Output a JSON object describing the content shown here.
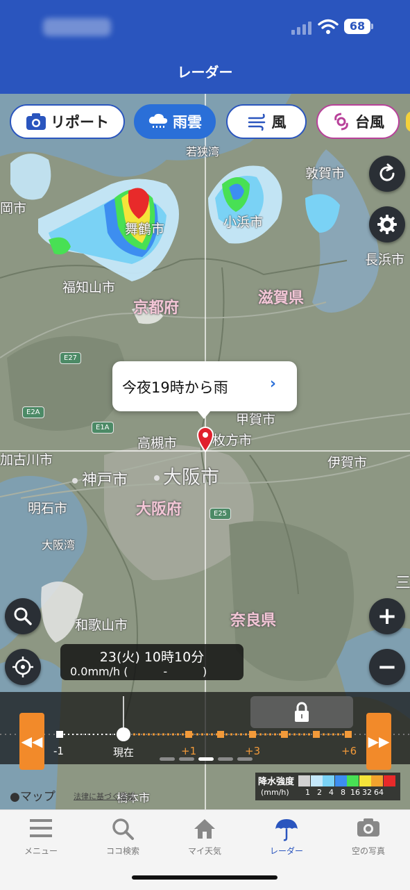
{
  "status_bar": {
    "battery": "68"
  },
  "header": {
    "title": "レーダー"
  },
  "layers": [
    {
      "label": "リポート",
      "icon": "camera-icon"
    },
    {
      "label": "雨雲",
      "icon": "cloud-rain-icon",
      "active": true
    },
    {
      "label": "風",
      "icon": "wind-icon"
    },
    {
      "label": "台風",
      "icon": "typhoon-icon"
    }
  ],
  "map": {
    "places": {
      "wakasa_bay": "若狭湾",
      "tsuruga": "敦賀市",
      "maizuru": "舞鶴市",
      "obama": "小浜市",
      "nagahama": "長浜市",
      "fukuchiyama": "福知山市",
      "kyoto_pref": "京都府",
      "shiga_pref": "滋賀県",
      "koka": "甲賀市",
      "takatsuki": "高槻市",
      "hirakata": "枚方市",
      "kakogawa": "加古川市",
      "iga": "伊賀市",
      "kobe": "神戸市",
      "osaka_city": "大阪市",
      "osaka_pref": "大阪府",
      "akashi": "明石市",
      "osaka_bay": "大阪湾",
      "wakayama": "和歌山市",
      "nara_pref": "奈良県",
      "left_edge_city": "岡市",
      "right_edge_mark": "三",
      "bottom_city": "橋本市"
    },
    "shields": [
      "E27",
      "E2A",
      "E1A",
      "E25"
    ],
    "pin_callout": "今夜19時から雨",
    "callout_chevron": "›"
  },
  "controls": {
    "refresh": "refresh-icon",
    "settings": "gear-icon",
    "search": "search-icon",
    "locate": "locate-icon",
    "zoom_in": "+",
    "zoom_out": "−"
  },
  "time_info": {
    "datetime": "23(火) 10時10分",
    "precip": "0.0mm/h (          -          )"
  },
  "timeline": {
    "labels": [
      "-1",
      "現在",
      "+1",
      "+3",
      "+6"
    ],
    "rewind": "◀◀",
    "forward": "▶▶"
  },
  "legend": {
    "title": "降水強度",
    "unit": "(mm/h)",
    "values": [
      "1",
      "2",
      "4",
      "8",
      "16",
      "32",
      "64"
    ],
    "colors": [
      "#d2d2d2",
      "#c5e8fa",
      "#7ad2f5",
      "#3d8ef0",
      "#48e054",
      "#f5e43a",
      "#f2a32e",
      "#e82a2a"
    ]
  },
  "attribution": {
    "maps": "マップ",
    "legal": "法律に基づく情報"
  },
  "tabs": [
    {
      "label": "メニュー",
      "icon": "menu-icon"
    },
    {
      "label": "ココ検索",
      "icon": "search-icon"
    },
    {
      "label": "マイ天気",
      "icon": "home-icon"
    },
    {
      "label": "レーダー",
      "icon": "umbrella-icon",
      "active": true
    },
    {
      "label": "空の写真",
      "icon": "camera-icon"
    }
  ]
}
